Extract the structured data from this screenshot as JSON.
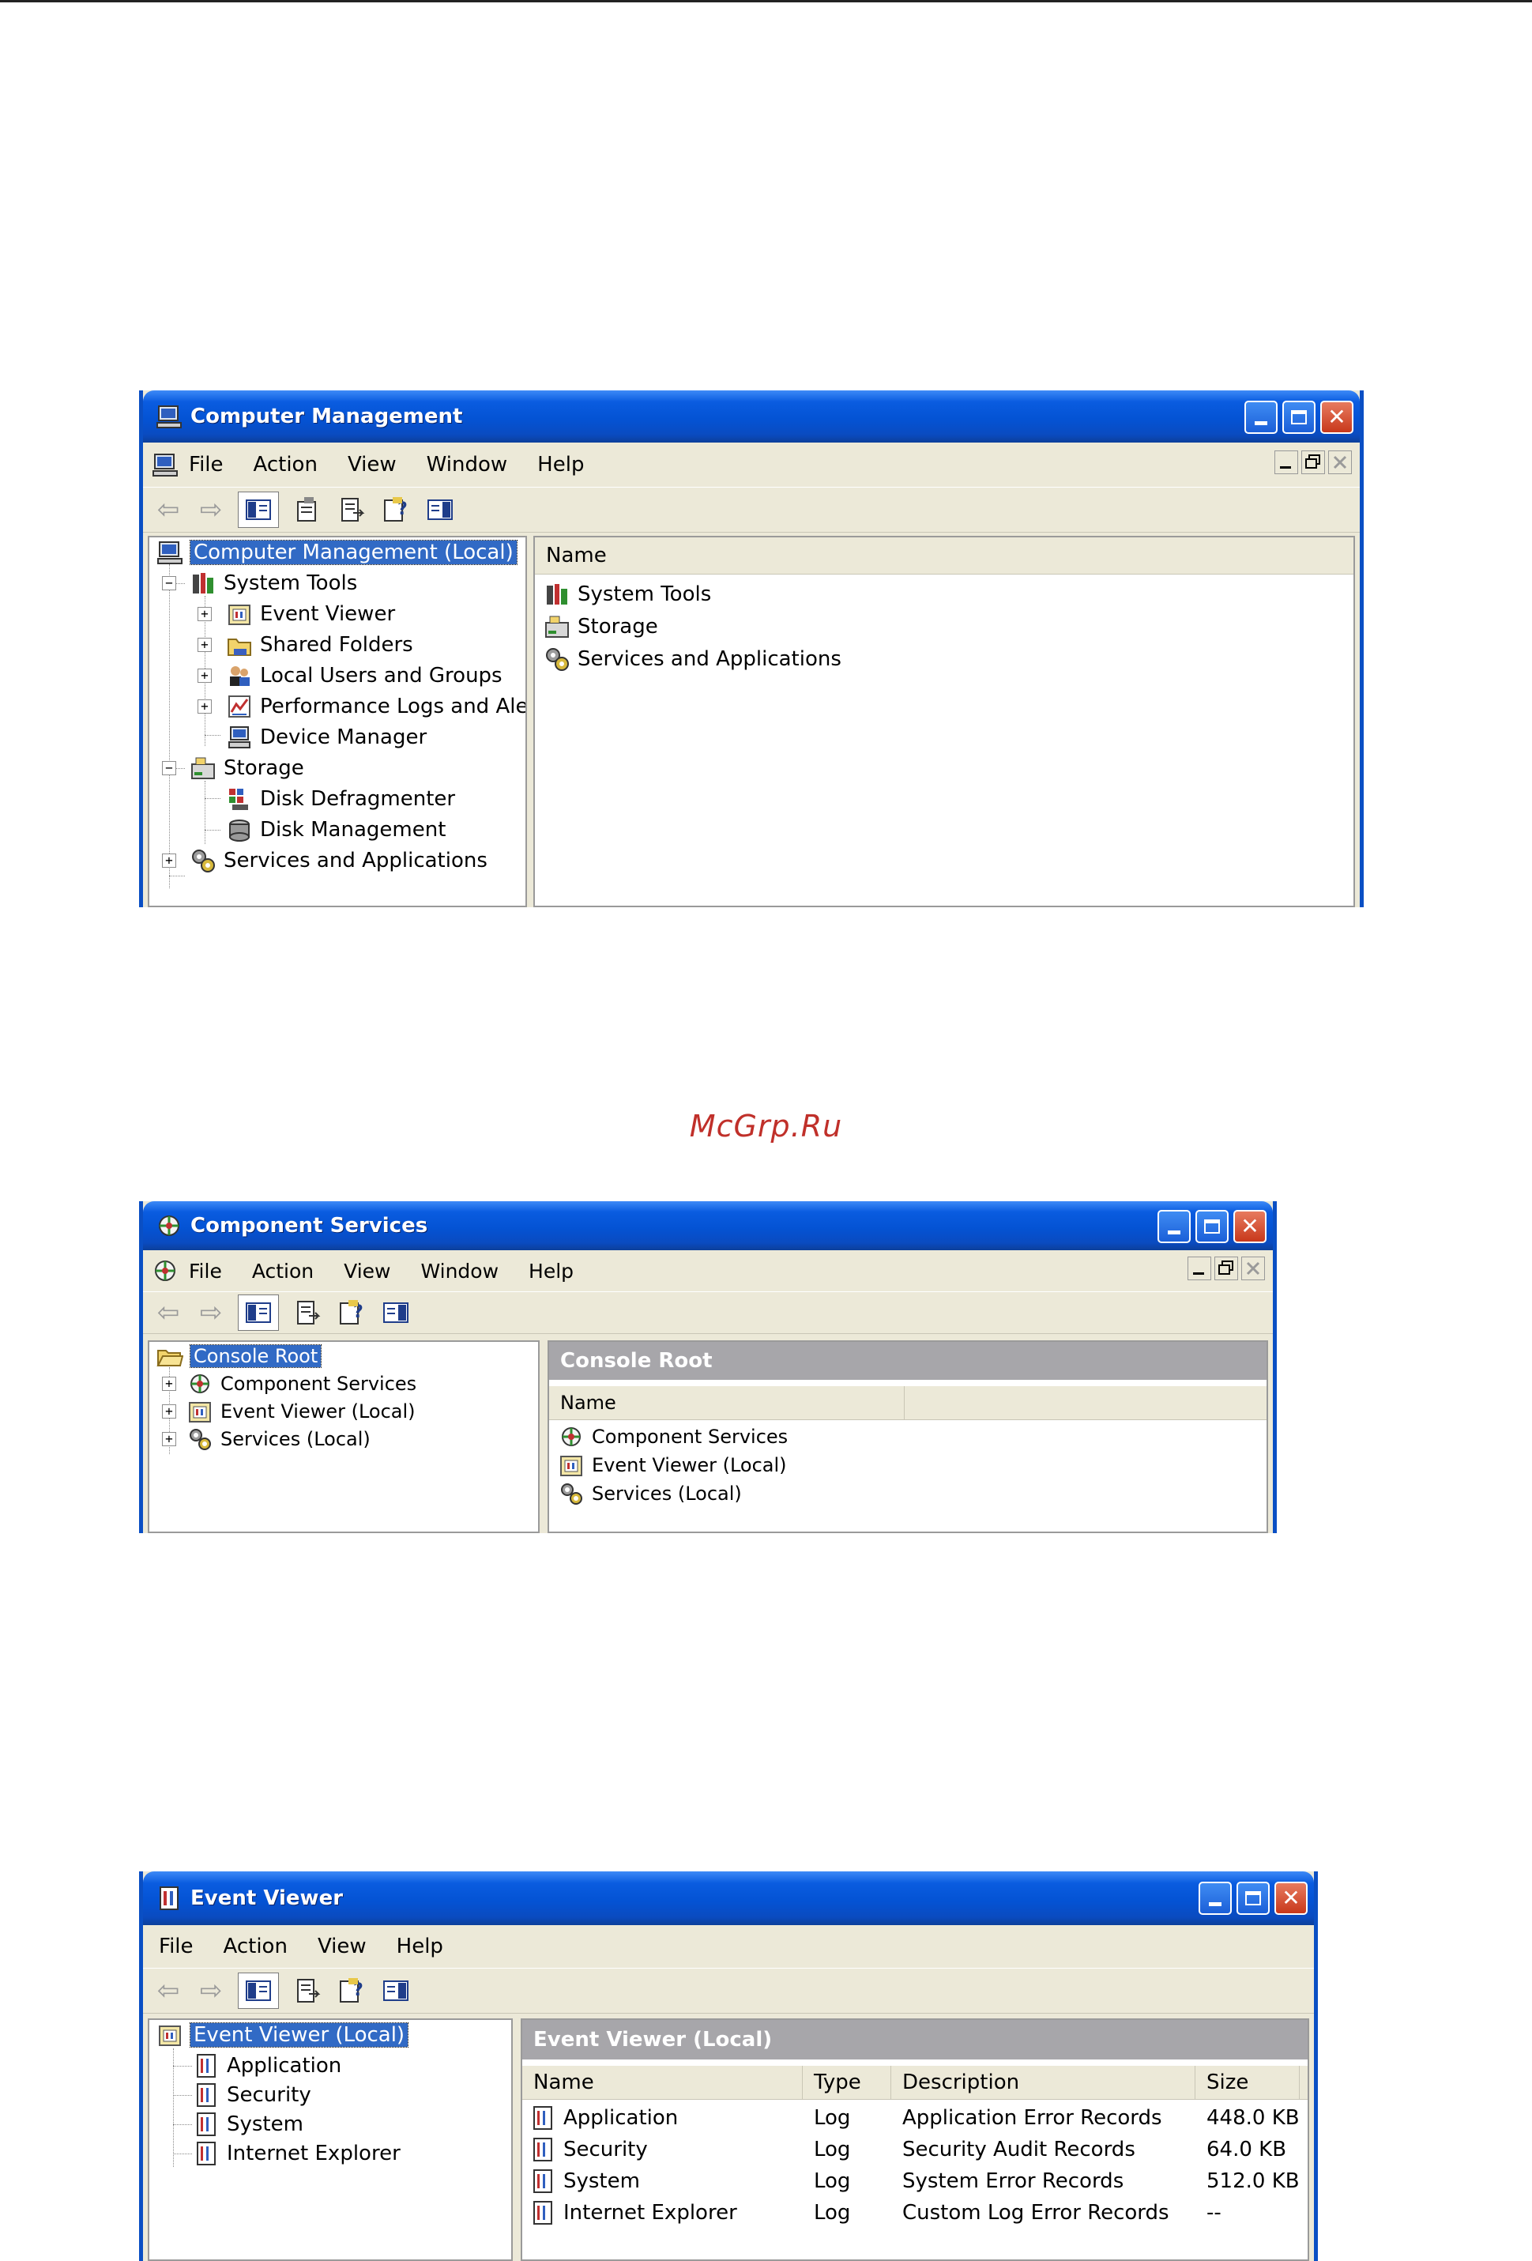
{
  "watermark": "McGrp.Ru",
  "cm": {
    "title": "Computer Management",
    "menu": [
      "File",
      "Action",
      "View",
      "Window",
      "Help"
    ],
    "tree": [
      {
        "label": "Computer Management (Local)",
        "icon": "computer-icon",
        "selected": true
      },
      {
        "label": "System Tools",
        "icon": "system-tools-icon",
        "expander": "−"
      },
      {
        "label": "Event Viewer",
        "icon": "event-viewer-icon",
        "expander": "+"
      },
      {
        "label": "Shared Folders",
        "icon": "folder-icon",
        "expander": "+"
      },
      {
        "label": "Local Users and Groups",
        "icon": "users-icon",
        "expander": "+"
      },
      {
        "label": "Performance Logs and Alerts",
        "icon": "performance-icon",
        "expander": "+"
      },
      {
        "label": "Device Manager",
        "icon": "device-manager-icon"
      },
      {
        "label": "Storage",
        "icon": "storage-icon",
        "expander": "−"
      },
      {
        "label": "Disk Defragmenter",
        "icon": "defrag-icon"
      },
      {
        "label": "Disk Management",
        "icon": "disk-icon"
      },
      {
        "label": "Services and Applications",
        "icon": "services-icon",
        "expander": "+"
      }
    ],
    "list_header": "Name",
    "list": [
      "System Tools",
      "Storage",
      "Services and Applications"
    ]
  },
  "cs": {
    "title": "Component Services",
    "menu": [
      "File",
      "Action",
      "View",
      "Window",
      "Help"
    ],
    "tree": [
      {
        "label": "Console Root",
        "icon": "folder-open-icon",
        "selected": true
      },
      {
        "label": "Component Services",
        "icon": "component-services-icon",
        "expander": "+"
      },
      {
        "label": "Event Viewer (Local)",
        "icon": "event-viewer-icon",
        "expander": "+"
      },
      {
        "label": "Services (Local)",
        "icon": "services-icon",
        "expander": "+"
      }
    ],
    "banner": "Console Root",
    "list_header": "Name",
    "list": [
      "Component Services",
      "Event Viewer (Local)",
      "Services (Local)"
    ]
  },
  "ev": {
    "title": "Event Viewer",
    "menu": [
      "File",
      "Action",
      "View",
      "Help"
    ],
    "tree": [
      {
        "label": "Event Viewer (Local)",
        "icon": "event-viewer-icon",
        "selected": true
      },
      {
        "label": "Application",
        "icon": "log-icon"
      },
      {
        "label": "Security",
        "icon": "log-icon"
      },
      {
        "label": "System",
        "icon": "log-icon"
      },
      {
        "label": "Internet Explorer",
        "icon": "log-icon"
      }
    ],
    "banner": "Event Viewer (Local)",
    "columns": [
      "Name",
      "Type",
      "Description",
      "Size"
    ],
    "rows": [
      {
        "name": "Application",
        "type": "Log",
        "description": "Application Error Records",
        "size": "448.0 KB"
      },
      {
        "name": "Security",
        "type": "Log",
        "description": "Security Audit Records",
        "size": "64.0 KB"
      },
      {
        "name": "System",
        "type": "Log",
        "description": "System Error Records",
        "size": "512.0 KB"
      },
      {
        "name": "Internet Explorer",
        "type": "Log",
        "description": "Custom Log Error Records",
        "size": "--"
      }
    ]
  }
}
